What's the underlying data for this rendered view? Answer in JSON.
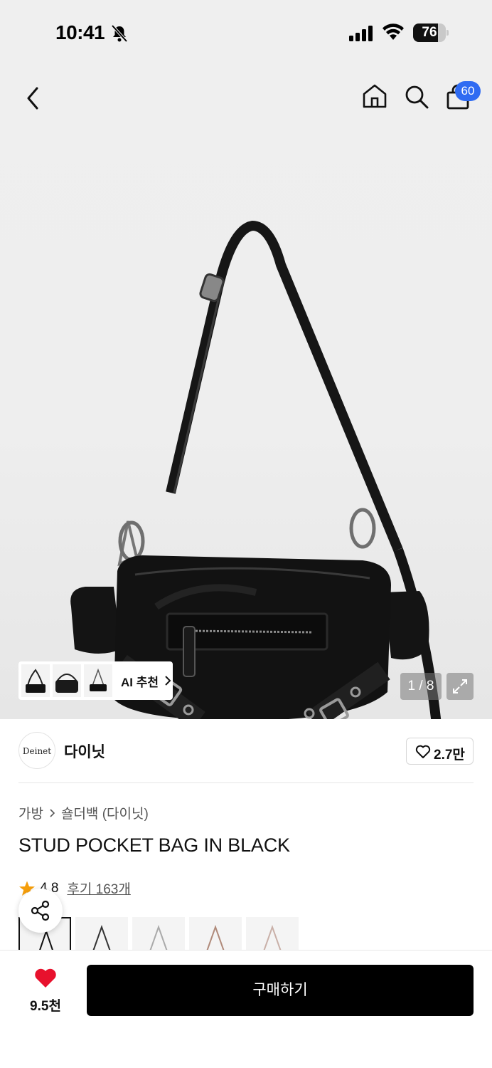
{
  "status_bar": {
    "time": "10:41",
    "battery": "76",
    "battery_level": 0.76
  },
  "nav": {
    "cart_count": "60"
  },
  "hero": {
    "ai_label": "AI 추천",
    "counter": "1 / 8"
  },
  "brand": {
    "logo_text": "Deinet",
    "name": "다이닛",
    "likes": "2.7만"
  },
  "breadcrumb": [
    "가방",
    "숄더백 (다이닛)"
  ],
  "product": {
    "title": "STUD POCKET BAG IN BLACK",
    "rating": "4.8",
    "reviews": "후기 163개"
  },
  "bottom": {
    "wish_count": "9.5천",
    "buy_label": "구매하기"
  },
  "colors": {
    "accent": "#2f6bf2",
    "heart": "#e8112d",
    "star": "#f59e0b"
  }
}
